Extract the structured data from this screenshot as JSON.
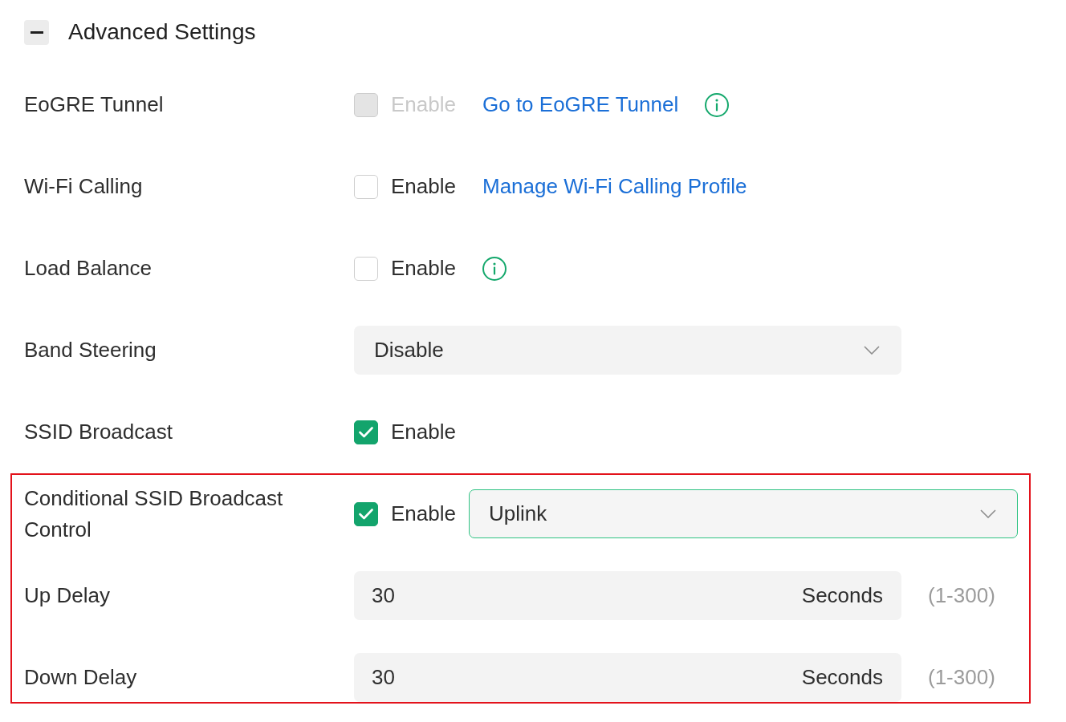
{
  "section": {
    "title": "Advanced Settings",
    "expanded": true
  },
  "groups": [
    {
      "outlined": false,
      "rows": [
        {
          "kind": "checkbox",
          "label": "EoGRE Tunnel",
          "checkbox": {
            "label": "Enable",
            "checked": false,
            "disabled": true
          },
          "link": "Go to EoGRE Tunnel",
          "info": true
        },
        {
          "kind": "checkbox",
          "label": "Wi-Fi Calling",
          "checkbox": {
            "label": "Enable",
            "checked": false,
            "disabled": false
          },
          "link": "Manage Wi-Fi Calling Profile"
        },
        {
          "kind": "checkbox",
          "label": "Load Balance",
          "checkbox": {
            "label": "Enable",
            "checked": false,
            "disabled": false
          },
          "info": true
        },
        {
          "kind": "select",
          "label": "Band Steering",
          "select": {
            "value": "Disable",
            "focused": false
          }
        },
        {
          "kind": "checkbox",
          "label": "SSID Broadcast",
          "checkbox": {
            "label": "Enable",
            "checked": true,
            "disabled": false
          }
        }
      ]
    },
    {
      "outlined": true,
      "rows": [
        {
          "kind": "checkbox",
          "label": "Conditional SSID Broadcast Control",
          "checkbox": {
            "label": "Enable",
            "checked": true,
            "disabled": false
          },
          "select": {
            "value": "Uplink",
            "focused": true
          }
        },
        {
          "kind": "number",
          "label": "Up Delay",
          "value": "30",
          "unit": "Seconds",
          "hint": "(1-300)"
        },
        {
          "kind": "number",
          "label": "Down Delay",
          "value": "30",
          "unit": "Seconds",
          "hint": "(1-300)"
        }
      ]
    }
  ]
}
